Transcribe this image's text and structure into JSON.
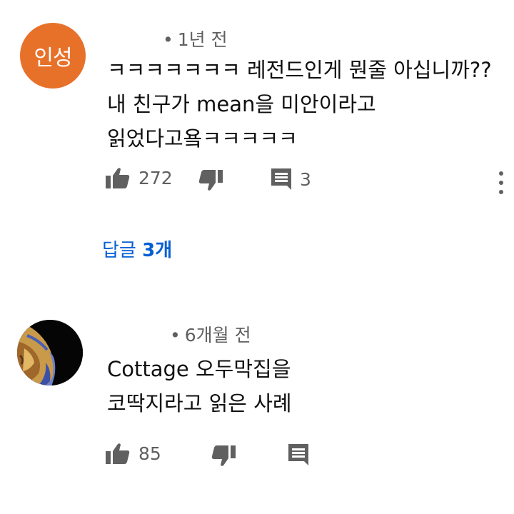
{
  "comments": [
    {
      "avatar_text": "인성",
      "avatar_color": "#e8712a",
      "time": "1년 전",
      "lines": [
        "ㅋㅋㅋㅋㅋㅋㅋ 레전드인게 뭔줄 아십니까??",
        "내 친구가 mean을 미안이라고",
        "읽었다고욬ㅋㅋㅋㅋㅋ"
      ],
      "likes": "272",
      "reply_count": "3",
      "replies_link_prefix": "답글",
      "replies_link_count": "3개"
    },
    {
      "time": "6개월 전",
      "lines": [
        "Cottage 오두막집을",
        "코딱지라고 읽은 사례"
      ],
      "likes": "85"
    }
  ],
  "icons": {
    "like": "thumbs-up-icon",
    "dislike": "thumbs-down-icon",
    "reply": "comment-icon",
    "more": "more-vert-icon"
  },
  "colors": {
    "link": "#065fd4",
    "secondary_text": "#606060"
  }
}
